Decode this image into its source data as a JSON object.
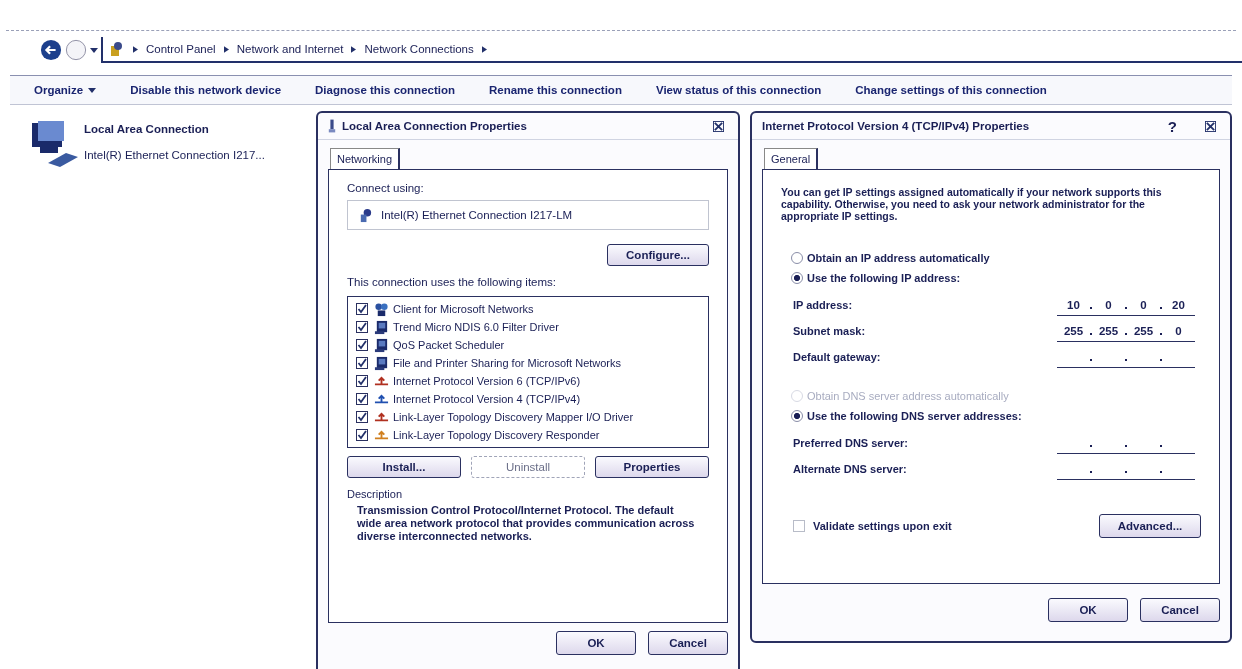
{
  "breadcrumb": [
    "Control Panel",
    "Network and Internet",
    "Network Connections"
  ],
  "toolbar": [
    {
      "label": "Organize",
      "dropdown": true
    },
    {
      "label": "Disable this network device",
      "dropdown": false
    },
    {
      "label": "Diagnose this connection",
      "dropdown": false
    },
    {
      "label": "Rename this connection",
      "dropdown": false
    },
    {
      "label": "View status of this connection",
      "dropdown": false
    },
    {
      "label": "Change settings of this connection",
      "dropdown": false
    }
  ],
  "connection": {
    "name": "Local Area Connection",
    "device": "Intel(R) Ethernet Connection I217..."
  },
  "lan_dialog": {
    "title": "Local Area Connection Properties",
    "tabs": [
      {
        "label": "Networking",
        "selected": true
      }
    ],
    "connect_using_label": "Connect using:",
    "adapter": "Intel(R) Ethernet Connection I217-LM",
    "configure_button": "Configure...",
    "items_label": "This connection uses the following items:",
    "items": [
      {
        "label": "Client for Microsoft Networks",
        "checked": true,
        "kind": "client"
      },
      {
        "label": "Trend Micro NDIS 6.0 Filter Driver",
        "checked": true,
        "kind": "service"
      },
      {
        "label": "QoS Packet Scheduler",
        "checked": true,
        "kind": "service"
      },
      {
        "label": "File and Printer Sharing for Microsoft Networks",
        "checked": true,
        "kind": "service"
      },
      {
        "label": "Internet Protocol Version 6 (TCP/IPv6)",
        "checked": true,
        "kind": "protocol",
        "color": "#b03020"
      },
      {
        "label": "Internet Protocol Version 4 (TCP/IPv4)",
        "checked": true,
        "kind": "protocol",
        "color": "#2050b0"
      },
      {
        "label": "Link-Layer Topology Discovery Mapper I/O Driver",
        "checked": true,
        "kind": "protocol",
        "color": "#b03020"
      },
      {
        "label": "Link-Layer Topology Discovery Responder",
        "checked": true,
        "kind": "protocol",
        "color": "#d08020"
      }
    ],
    "item_buttons": [
      {
        "label": "Install...",
        "disabled": false
      },
      {
        "label": "Uninstall",
        "disabled": true
      },
      {
        "label": "Properties",
        "disabled": false
      }
    ],
    "description_label": "Description",
    "description": "Transmission Control Protocol/Internet Protocol. The default wide area network protocol that provides communication across diverse interconnected networks.",
    "buttons": [
      "OK",
      "Cancel"
    ]
  },
  "ipv4_dialog": {
    "title": "Internet Protocol Version 4 (TCP/IPv4) Properties",
    "help_button": "?",
    "tabs": [
      {
        "label": "General",
        "selected": true
      }
    ],
    "intro": "You can get IP settings assigned automatically if your network supports this capability. Otherwise, you need to ask your network administrator for the appropriate IP settings.",
    "ip_radios": [
      {
        "label": "Obtain an IP address automatically",
        "selected": false,
        "disabled": false
      },
      {
        "label": "Use the following IP address:",
        "selected": true,
        "disabled": false
      }
    ],
    "ip_fields": [
      {
        "label": "IP address:",
        "octets": [
          "10",
          "0",
          "0",
          "20"
        ]
      },
      {
        "label": "Subnet mask:",
        "octets": [
          "255",
          "255",
          "255",
          "0"
        ]
      },
      {
        "label": "Default gateway:"
      }
    ],
    "dns_radios": [
      {
        "label": "Obtain DNS server address automatically",
        "selected": false,
        "disabled": true
      },
      {
        "label": "Use the following DNS server addresses:",
        "selected": true,
        "disabled": false
      }
    ],
    "dns_fields": [
      {
        "label": "Preferred DNS server:"
      },
      {
        "label": "Alternate DNS server:"
      }
    ],
    "validate": {
      "label": "Validate settings upon exit",
      "checked": false
    },
    "advanced_button": "Advanced...",
    "buttons": [
      "OK",
      "Cancel"
    ]
  }
}
